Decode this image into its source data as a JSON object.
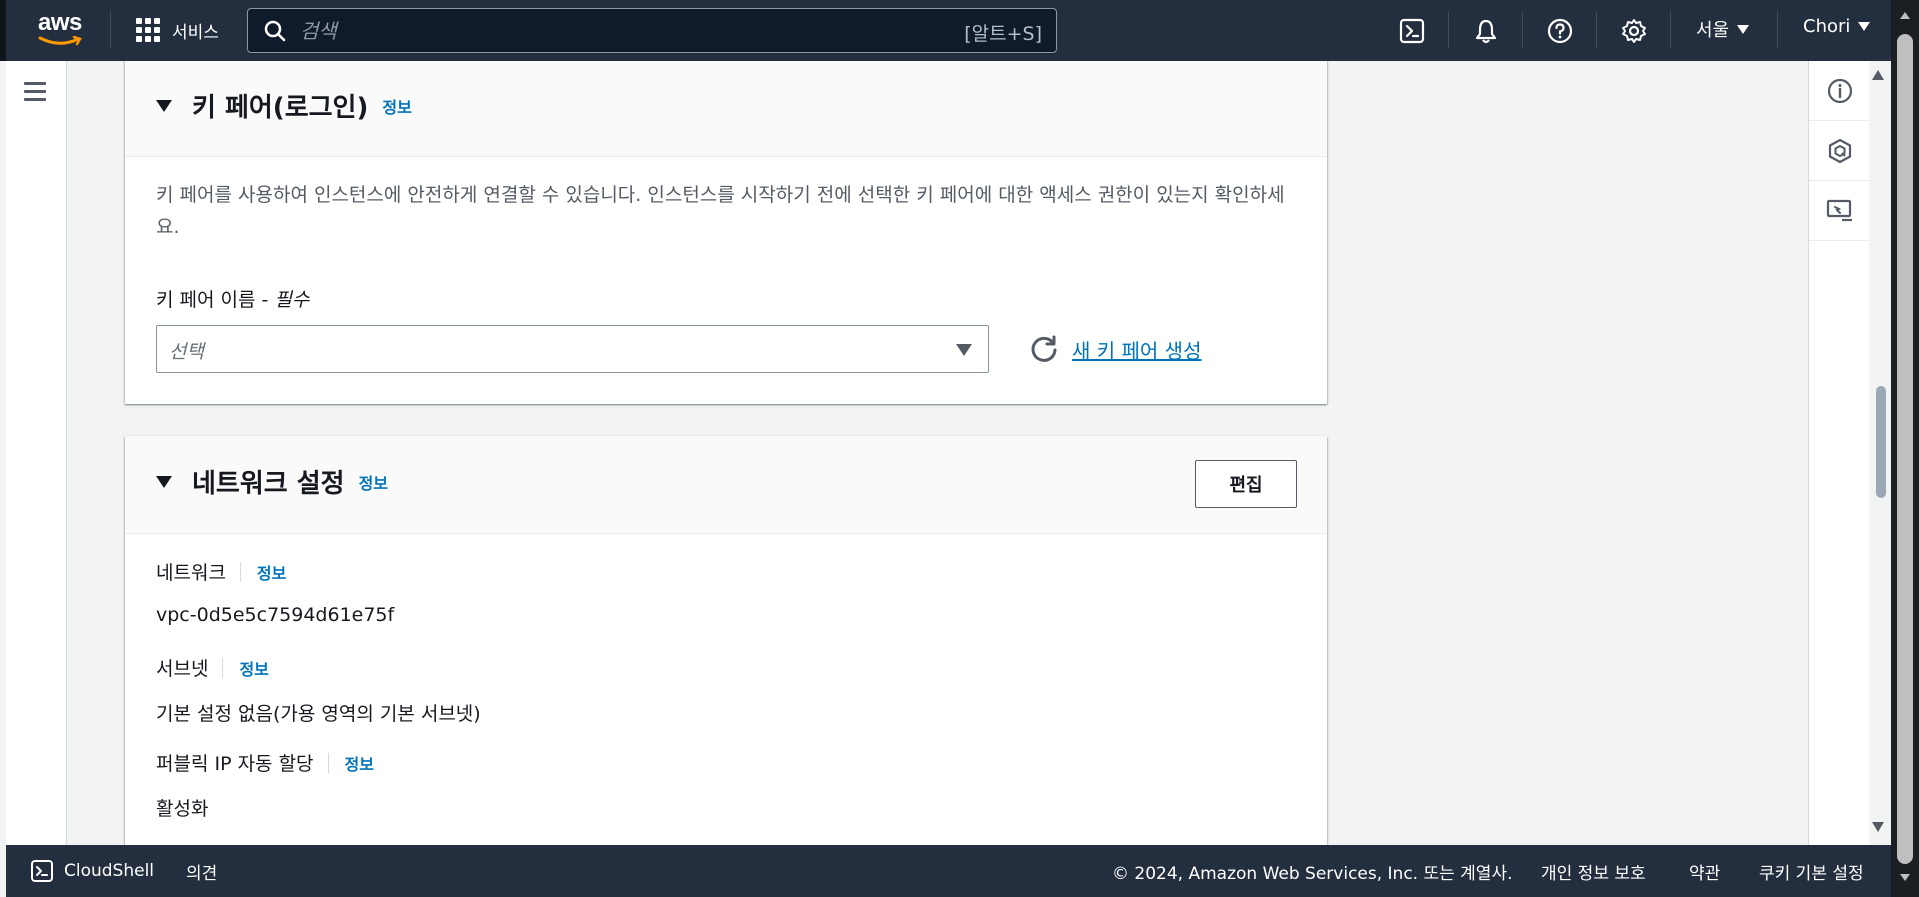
{
  "nav": {
    "logo_text": "aws",
    "services_label": "서비스",
    "search_placeholder": "검색",
    "search_shortcut": "[알트+S]",
    "region": "서울",
    "account": "Chori"
  },
  "key_pair": {
    "title": "키 페어(로그인)",
    "info": "정보",
    "description": "키 페어를 사용하여 인스턴스에 안전하게 연결할 수 있습니다. 인스턴스를 시작하기 전에 선택한 키 페어에 대한 액세스 권한이 있는지 확인하세요.",
    "field_label": "키 페어 이름 - ",
    "field_required": "필수",
    "select_placeholder": "선택",
    "create_link": "새 키 페어 생성"
  },
  "network": {
    "title": "네트워크 설정",
    "info": "정보",
    "edit_button": "편집",
    "fields": [
      {
        "label": "네트워크",
        "info": "정보",
        "value": "vpc-0d5e5c7594d61e75f"
      },
      {
        "label": "서브넷",
        "info": "정보",
        "value": "기본 설정 없음(가용 영역의 기본 서브넷)"
      },
      {
        "label": "퍼블릭 IP 자동 할당",
        "info": "정보",
        "value": "활성화"
      }
    ]
  },
  "footer": {
    "cloudshell": "CloudShell",
    "feedback": "의견",
    "copyright": "© 2024, Amazon Web Services, Inc. 또는 계열사.",
    "privacy": "개인 정보 보호",
    "terms": "약관",
    "cookies": "쿠키 기본 설정"
  },
  "colors": {
    "nav_bg": "#232f3e",
    "link": "#0073bb",
    "aws_orange": "#ff9900"
  }
}
